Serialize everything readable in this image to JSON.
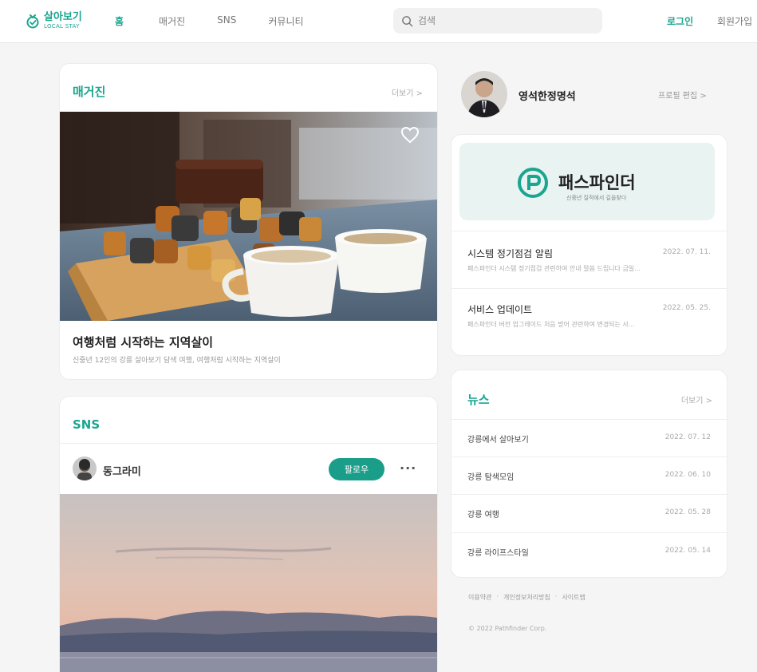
{
  "header": {
    "logo_main": "살아보기",
    "logo_sub": "LOCAL STAY",
    "nav": [
      {
        "label": "홈"
      },
      {
        "label": "매거진"
      },
      {
        "label": "SNS"
      },
      {
        "label": "커뮤니티"
      }
    ],
    "search_placeholder": "검색",
    "login_label": "로그인",
    "signup_label": "회원가입",
    "accent_color": "#1aa58f"
  },
  "magazine": {
    "title": "매거진",
    "more": "더보기 >",
    "headline": "여행처럼 시작하는 지역살이",
    "description": "신중년 12인의 강릉 살아보기 담색 여행, 여행처럼 시작하는 지역살이"
  },
  "sns": {
    "title": "SNS",
    "username": "동그라미",
    "follow_label": "팔로우",
    "more_label": "···"
  },
  "profile": {
    "name": "영석한정명석",
    "edit_label": "프로필 편집 >"
  },
  "banner": {
    "title": "패스파인더",
    "subtitle": "신중년 질적에서 길을찾다"
  },
  "notices": [
    {
      "title": "시스템 정기점검 알림",
      "date": "2022. 07. 11.",
      "desc": "패스파인더 시스템 정기점검 관련하여 안내 말씀 드립니다 금일..."
    },
    {
      "title": "서비스 업데이트",
      "date": "2022. 05. 25.",
      "desc": "패스파인더 버전 업그레이드 처음 방어 관련하여 변경되는 사..."
    }
  ],
  "news": {
    "title": "뉴스",
    "more": "더보기 >",
    "items": [
      {
        "title": "강릉에서 살아보기",
        "date": "2022. 07. 12"
      },
      {
        "title": "강릉 탐색모임",
        "date": "2022. 06. 10"
      },
      {
        "title": "강릉 여행",
        "date": "2022. 05. 28"
      },
      {
        "title": "강릉 라이프스타일",
        "date": "2022. 05. 14"
      }
    ]
  },
  "footer": {
    "links": [
      "이용약관",
      "개인정보처리방침",
      "사이트맵"
    ],
    "copyright": "© 2022 Pathfinder Corp."
  }
}
